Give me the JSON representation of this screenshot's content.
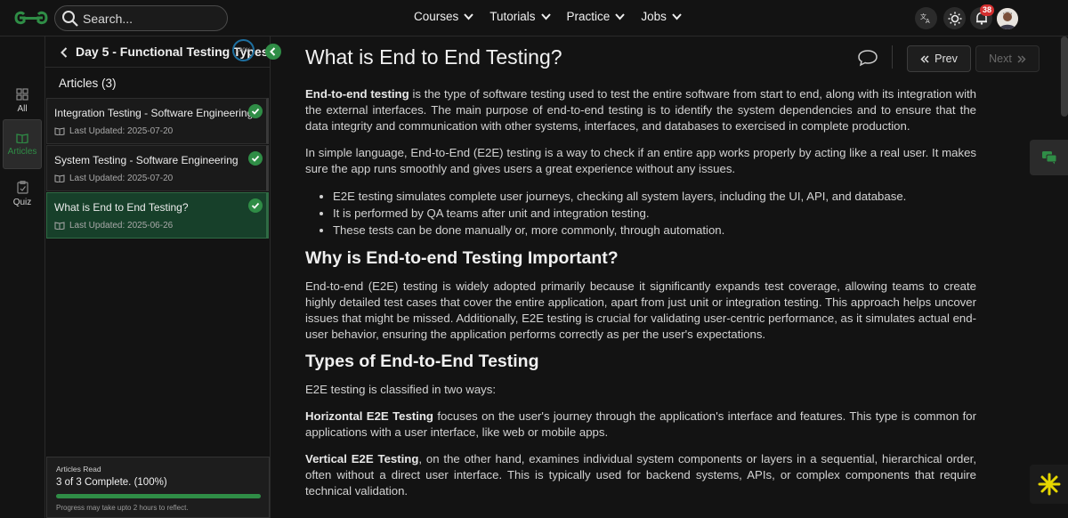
{
  "header": {
    "search_placeholder": "Search...",
    "nav": [
      "Courses",
      "Tutorials",
      "Practice",
      "Jobs"
    ],
    "notification_count": "38"
  },
  "rail": {
    "items": [
      {
        "label": "All",
        "icon": "grid-icon"
      },
      {
        "label": "Articles",
        "icon": "book-icon"
      },
      {
        "label": "Quiz",
        "icon": "clipboard-icon"
      }
    ],
    "active": "Articles"
  },
  "sidebar": {
    "title": "Day 5 - Functional Testing Types",
    "progress_label": "100%",
    "articles_heading": "Articles (3)",
    "articles": [
      {
        "title": "Integration Testing - Software Engineering",
        "date": "Last Updated: 2025-07-20",
        "completed": true
      },
      {
        "title": "System Testing - Software Engineering",
        "date": "Last Updated: 2025-07-20",
        "completed": true
      },
      {
        "title": "What is End to End Testing?",
        "date": "Last Updated: 2025-06-26",
        "completed": true
      }
    ],
    "read_box": {
      "label": "Articles Read",
      "complete": "3 of 3 Complete. (100%)",
      "progress": 1.0,
      "note": "Progress may take upto 2 hours to reflect."
    }
  },
  "article": {
    "title": "What is End to End Testing?",
    "prev_label": "Prev",
    "next_label": "Next",
    "p1_bold": "End-to-end testing",
    "p1_rest": " is the type of software testing used to test the entire software from start to end, along with its integration with the external interfaces. The main purpose of end-to-end testing is to identify the system dependencies and to ensure that the data integrity and communication with other systems, interfaces, and databases to exercised in complete production.",
    "p2": "In simple language, End-to-End (E2E) testing is a way to check if an entire app works properly by acting like a real user. It makes sure the app runs smoothly and gives users a great experience without any issues.",
    "bullets": [
      "E2E testing simulates complete user journeys, checking all system layers, including the UI, API, and database.",
      "It is performed by QA teams after unit and integration testing.",
      "These tests can be done manually or, more commonly, through automation."
    ],
    "h2_why": "Why is End-to-end Testing Important?",
    "p_why": "End-to-end (E2E) testing is widely adopted primarily because it significantly expands test coverage, allowing teams to create highly detailed test cases that cover the entire application, apart from just unit or integration testing. This approach helps uncover issues that might be missed. Additionally, E2E testing is crucial for validating user-centric performance, as it simulates actual end-user behavior, ensuring the application performs correctly as per the user's expectations.",
    "h2_types": "Types of End-to-End Testing",
    "p_types": "E2E testing is classified in two ways:",
    "horizontal_bold": "Horizontal E2E Testing",
    "horizontal_rest": " focuses on the user's journey through the application's interface and features. This type is common for applications with a user interface, like web or mobile apps.",
    "vertical_bold": "Vertical E2E Testing",
    "vertical_rest": ", on the other hand, examines individual system components or layers in a sequential, hierarchical order, often without a direct user interface. This is typically used for backend systems, APIs, or complex components that require technical validation."
  },
  "colors": {
    "accent": "#2f8d46",
    "background": "#131313",
    "active_card": "#17402a"
  }
}
